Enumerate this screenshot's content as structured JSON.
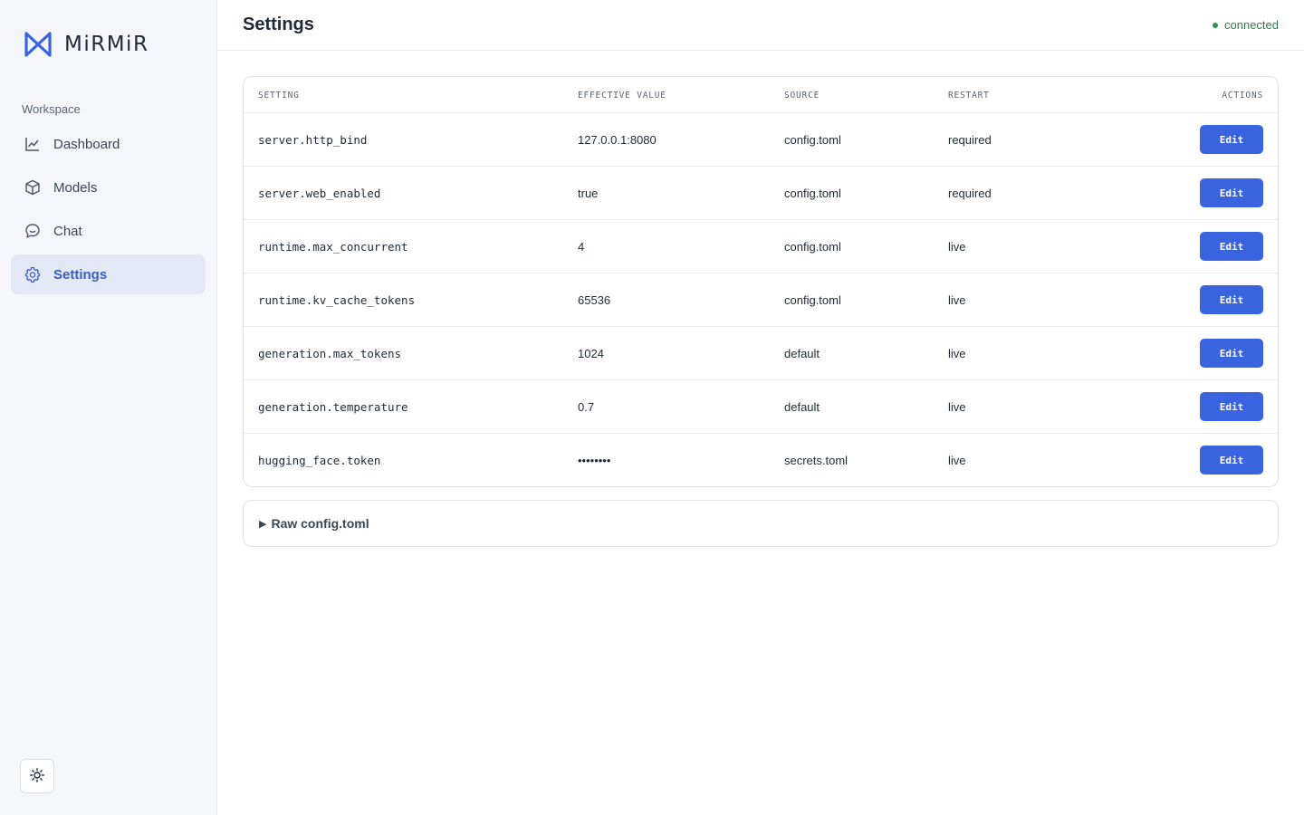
{
  "brand": {
    "name": "MiRMiR",
    "accent": "#3a63e0"
  },
  "sidebar": {
    "section_label": "Workspace",
    "items": [
      {
        "label": "Dashboard",
        "icon": "chart-line-icon",
        "active": false
      },
      {
        "label": "Models",
        "icon": "cube-icon",
        "active": false
      },
      {
        "label": "Chat",
        "icon": "chat-bubble-icon",
        "active": false
      },
      {
        "label": "Settings",
        "icon": "gear-icon",
        "active": true
      }
    ],
    "theme_toggle_icon": "sun-icon"
  },
  "header": {
    "title": "Settings",
    "status": "connected",
    "status_color": "#2f8f4e"
  },
  "table": {
    "columns": {
      "setting": "SETTING",
      "value": "EFFECTIVE VALUE",
      "source": "SOURCE",
      "restart": "RESTART",
      "actions": "ACTIONS"
    },
    "rows": [
      {
        "setting": "server.http_bind",
        "value": "127.0.0.1:8080",
        "source": "config.toml",
        "restart": "required",
        "action": "Edit"
      },
      {
        "setting": "server.web_enabled",
        "value": "true",
        "source": "config.toml",
        "restart": "required",
        "action": "Edit"
      },
      {
        "setting": "runtime.max_concurrent",
        "value": "4",
        "source": "config.toml",
        "restart": "live",
        "action": "Edit"
      },
      {
        "setting": "runtime.kv_cache_tokens",
        "value": "65536",
        "source": "config.toml",
        "restart": "live",
        "action": "Edit"
      },
      {
        "setting": "generation.max_tokens",
        "value": "1024",
        "source": "default",
        "restart": "live",
        "action": "Edit"
      },
      {
        "setting": "generation.temperature",
        "value": "0.7",
        "source": "default",
        "restart": "live",
        "action": "Edit"
      },
      {
        "setting": "hugging_face.token",
        "value": "••••••••",
        "source": "secrets.toml",
        "restart": "live",
        "action": "Edit"
      }
    ]
  },
  "raw_config": {
    "arrow": "▶",
    "label": "Raw config.toml"
  }
}
